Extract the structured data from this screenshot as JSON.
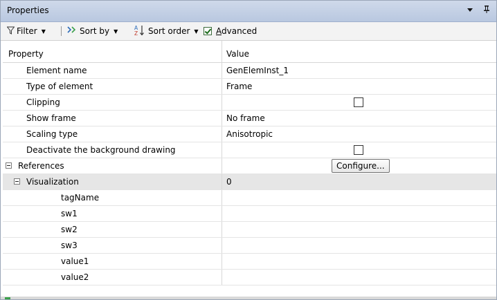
{
  "panel": {
    "title": "Properties"
  },
  "toolbar": {
    "filter_label": "Filter",
    "sortby_label": "Sort by",
    "sortorder_label": "Sort order",
    "advanced_label": "Advanced",
    "advanced_checked": true
  },
  "grid": {
    "columns": [
      "Property",
      "Value"
    ],
    "rows": [
      {
        "name": "Element name",
        "value": "GenElemInst_1"
      },
      {
        "name": "Type of element",
        "value": "Frame"
      },
      {
        "name": "Clipping",
        "checkbox": false
      },
      {
        "name": "Show frame",
        "value": "No frame"
      },
      {
        "name": "Scaling type",
        "value": "Anisotropic"
      },
      {
        "name": "Deactivate the background drawing",
        "checkbox": false
      },
      {
        "name": "References",
        "button": "Configure..."
      },
      {
        "name": "Visualization",
        "value": "0"
      },
      {
        "name": "tagName",
        "value": ""
      },
      {
        "name": "sw1",
        "value": ""
      },
      {
        "name": "sw2",
        "value": ""
      },
      {
        "name": "sw3",
        "value": ""
      },
      {
        "name": "value1",
        "value": ""
      },
      {
        "name": "value2",
        "value": ""
      }
    ]
  },
  "icons": {
    "filter": "filter-icon",
    "sortby": "sort-by-icon",
    "sortorder": "sort-az-icon",
    "dropdown": "chevron-down-icon",
    "pin": "pin-icon"
  },
  "colors": {
    "titlebar": "#c4d1e6",
    "selected_row": "#e6e6e6",
    "check_green": "#1c6c1c"
  }
}
